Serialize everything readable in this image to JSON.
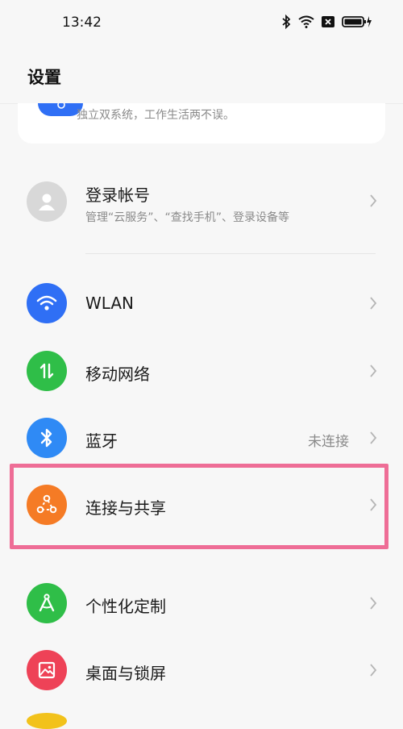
{
  "status_bar": {
    "time": "13:42"
  },
  "header": {
    "title": "设置"
  },
  "partial_card": {
    "description": "独立双系统，工作生活两不误。"
  },
  "account": {
    "title": "登录帐号",
    "subtitle": "管理“云服务”、“查找手机”、登录设备等"
  },
  "items": [
    {
      "label": "WLAN",
      "value": "",
      "icon": "wifi-icon",
      "color": "#2f6ff5"
    },
    {
      "label": "移动网络",
      "value": "",
      "icon": "mobile-data-icon",
      "color": "#2fbe48"
    },
    {
      "label": "蓝牙",
      "value": "未连接",
      "icon": "bluetooth-icon",
      "color": "#2f8af5"
    },
    {
      "label": "连接与共享",
      "value": "",
      "icon": "share-icon",
      "color": "#f57b25"
    },
    {
      "label": "个性化定制",
      "value": "",
      "icon": "personalize-icon",
      "color": "#2fbe48"
    },
    {
      "label": "桌面与锁屏",
      "value": "",
      "icon": "wallpaper-icon",
      "color": "#ee4257"
    }
  ],
  "colors": {
    "highlight": "#ee6d96",
    "accent_blue": "#2f6ff5"
  }
}
